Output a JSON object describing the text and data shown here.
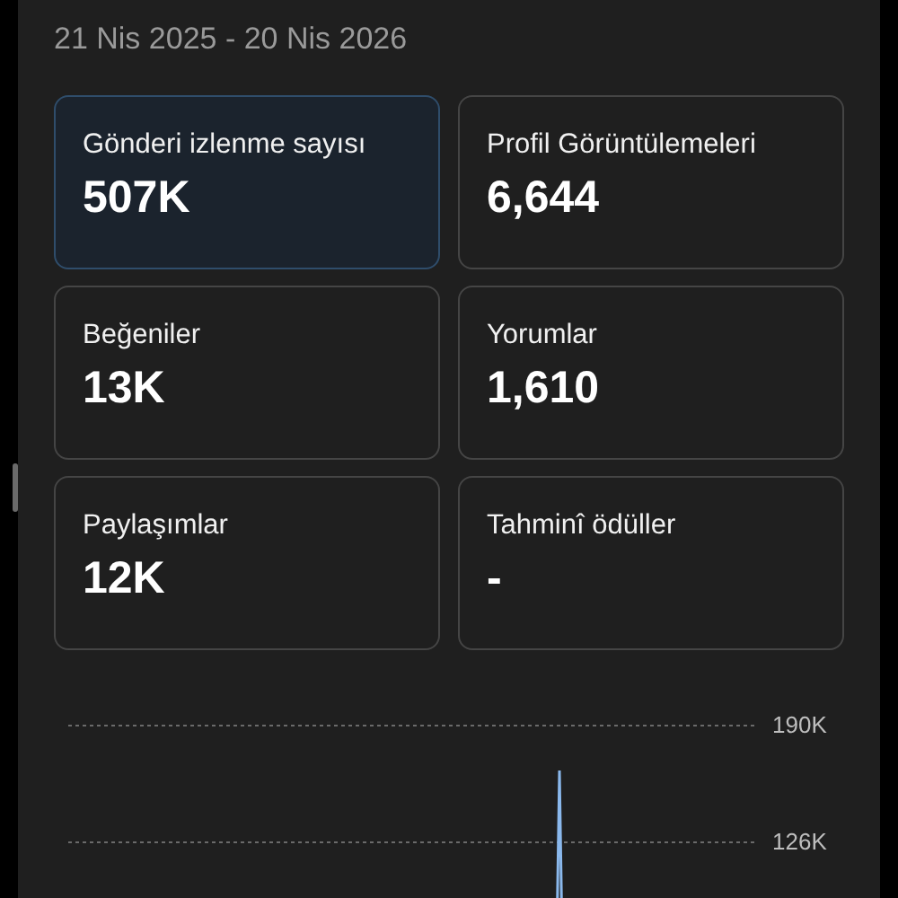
{
  "date_range": "21 Nis 2025 - 20 Nis 2026",
  "metrics": [
    {
      "label": "Gönderi izlenme sayısı",
      "value": "507K",
      "selected": true
    },
    {
      "label": "Profil Görüntülemeleri",
      "value": "6,644",
      "selected": false
    },
    {
      "label": "Beğeniler",
      "value": "13K",
      "selected": false
    },
    {
      "label": "Yorumlar",
      "value": "1,610",
      "selected": false
    },
    {
      "label": "Paylaşımlar",
      "value": "12K",
      "selected": false
    },
    {
      "label": "Tahminî ödüller",
      "value": "-",
      "selected": false
    }
  ],
  "chart": {
    "gridline_labels": [
      "190K",
      "126K"
    ]
  }
}
